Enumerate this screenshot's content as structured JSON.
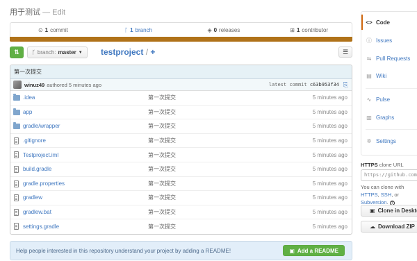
{
  "description": {
    "text": "用于测试",
    "edit_label": "— Edit"
  },
  "summary": {
    "commits": {
      "count": "1",
      "label": "commit"
    },
    "branches": {
      "count": "1",
      "label": "branch"
    },
    "releases": {
      "count": "0",
      "label": "releases"
    },
    "contributors": {
      "count": "1",
      "label": "contributor"
    }
  },
  "language_color": "#b07219",
  "toolbar": {
    "branch_label": "branch:",
    "branch_name": "master",
    "repo_name": "testproject",
    "path_sep": "/",
    "add_label": "+"
  },
  "commit": {
    "message": "第一次提交",
    "author": "winuz49",
    "authored": "authored 5 minutes ago",
    "latest_label": "latest commit",
    "sha": "c63b953f34"
  },
  "files": [
    {
      "name": ".idea",
      "type": "folder",
      "message": "第一次提交",
      "age": "5 minutes ago"
    },
    {
      "name": "app",
      "type": "folder",
      "message": "第一次提交",
      "age": "5 minutes ago"
    },
    {
      "name": "gradle/wrapper",
      "type": "folder",
      "message": "第一次提交",
      "age": "5 minutes ago"
    },
    {
      "name": ".gitignore",
      "type": "file",
      "message": "第一次提交",
      "age": "5 minutes ago"
    },
    {
      "name": "Testproject.iml",
      "type": "file",
      "message": "第一次提交",
      "age": "5 minutes ago"
    },
    {
      "name": "build.gradle",
      "type": "file",
      "message": "第一次提交",
      "age": "5 minutes ago"
    },
    {
      "name": "gradle.properties",
      "type": "file",
      "message": "第一次提交",
      "age": "5 minutes ago"
    },
    {
      "name": "gradlew",
      "type": "file",
      "message": "第一次提交",
      "age": "5 minutes ago"
    },
    {
      "name": "gradlew.bat",
      "type": "file",
      "message": "第一次提交",
      "age": "5 minutes ago"
    },
    {
      "name": "settings.gradle",
      "type": "file",
      "message": "第一次提交",
      "age": "5 minutes ago"
    }
  ],
  "readme": {
    "prompt": "Help people interested in this repository understand your project by adding a README!",
    "button_label": "Add a README"
  },
  "sidebar": {
    "items": [
      {
        "label": "Code",
        "icon": "code-icon"
      },
      {
        "label": "Issues",
        "icon": "issue-icon"
      },
      {
        "label": "Pull Requests",
        "icon": "pull-request-icon"
      },
      {
        "label": "Wiki",
        "icon": "wiki-icon"
      },
      {
        "label": "Pulse",
        "icon": "pulse-icon"
      },
      {
        "label": "Graphs",
        "icon": "graph-icon"
      },
      {
        "label": "Settings",
        "icon": "settings-icon"
      }
    ],
    "clone_protocol": "HTTPS",
    "clone_label": "clone URL",
    "clone_url": "https://github.com/",
    "clone_help_prefix": "You can clone with",
    "clone_help_https": "HTTPS",
    "clone_help_ssh": "SSH",
    "clone_help_or": ", or",
    "clone_help_subversion": "Subversion",
    "clone_help_dot": ".",
    "clone_help_q": "?",
    "clone_desktop_label": "Clone in Desktop",
    "download_zip_label": "Download ZIP"
  }
}
